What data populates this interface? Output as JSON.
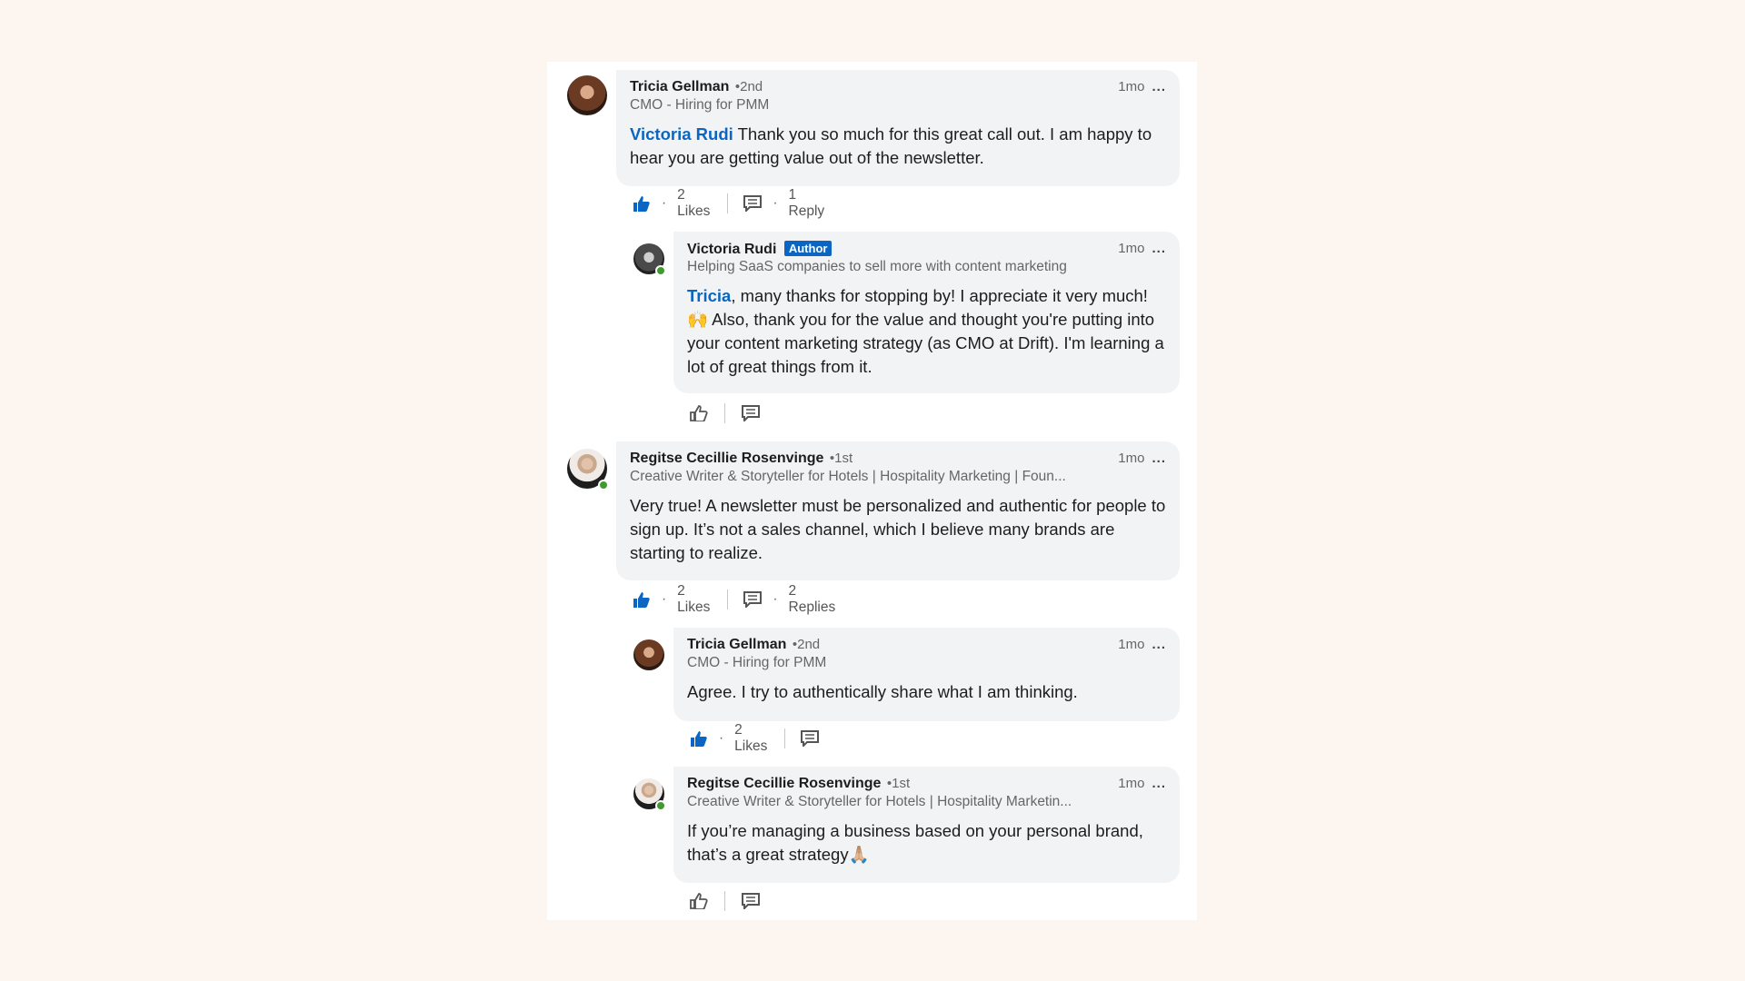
{
  "comments": [
    {
      "name": "Tricia Gellman",
      "degree": "•2nd",
      "headline": "CMO - Hiring for PMM",
      "time": "1mo",
      "mention": "Victoria Rudi",
      "text": " Thank you so much for this great call out. I am happy to hear you are getting value out of the newsletter.",
      "likes": "2 Likes",
      "replies": "1 Reply"
    },
    {
      "name": "Victoria Rudi",
      "badge": "Author",
      "headline": "Helping SaaS companies to sell more with content marketing",
      "time": "1mo",
      "mention": "Tricia",
      "text": ", many thanks for stopping by! I appreciate it very much! 🙌 Also, thank you for the value and thought you're putting into your content marketing strategy (as CMO at Drift). I'm learning a lot of great things from it."
    },
    {
      "name": "Regitse Cecillie Rosenvinge",
      "degree": "•1st",
      "headline": "Creative Writer & Storyteller for Hotels | Hospitality Marketing | Foun...",
      "time": "1mo",
      "text": "Very true! A newsletter must be personalized and authentic for people to sign up. It’s not a sales channel, which I believe many brands are starting to realize.",
      "likes": "2 Likes",
      "replies": "2 Replies"
    },
    {
      "name": "Tricia Gellman",
      "degree": "•2nd",
      "headline": "CMO - Hiring for PMM",
      "time": "1mo",
      "text": "Agree. I try to authentically share what I am thinking.",
      "likes": "2 Likes"
    },
    {
      "name": "Regitse Cecillie Rosenvinge",
      "degree": "•1st",
      "headline": "Creative Writer & Storyteller for Hotels | Hospitality Marketin...",
      "time": "1mo",
      "text": "If you’re managing a business based on your personal brand, that’s a great strategy🙏🏼"
    }
  ],
  "dots": "...",
  "actions_dot": "·",
  "colors": {
    "accent": "#0a66c2",
    "bubble": "#f2f3f5",
    "online": "#3f9b2e",
    "page_bg": "#fdf5ef"
  },
  "icons": {
    "like_filled": "thumbs-up-filled-icon",
    "like_outline": "thumbs-up-outline-icon",
    "reply": "comment-icon",
    "more": "more-dots-icon"
  }
}
